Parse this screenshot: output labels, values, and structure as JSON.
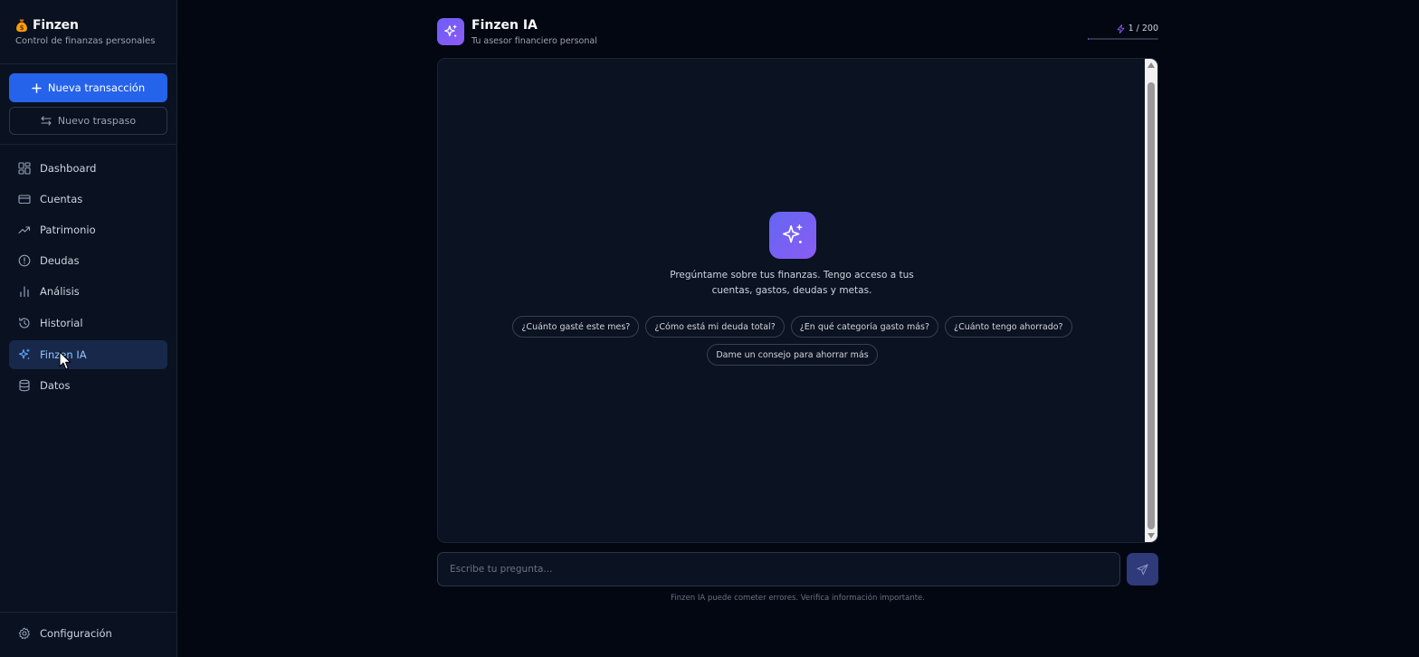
{
  "brand": {
    "title": "Finzen",
    "subtitle": "Control de finanzas personales",
    "icon": "money-bag-icon"
  },
  "actions": {
    "new_transaction": "Nueva transacción",
    "new_transfer": "Nuevo traspaso"
  },
  "nav": {
    "items": [
      {
        "label": "Dashboard",
        "icon": "grid-icon"
      },
      {
        "label": "Cuentas",
        "icon": "credit-card-icon"
      },
      {
        "label": "Patrimonio",
        "icon": "trending-up-icon"
      },
      {
        "label": "Deudas",
        "icon": "alert-circle-icon"
      },
      {
        "label": "Análisis",
        "icon": "bar-chart-icon"
      },
      {
        "label": "Historial",
        "icon": "history-icon"
      },
      {
        "label": "Finzen IA",
        "icon": "sparkles-icon",
        "active": true
      },
      {
        "label": "Datos",
        "icon": "database-icon"
      }
    ],
    "settings": "Configuración"
  },
  "chat": {
    "title": "Finzen IA",
    "subtitle": "Tu asesor financiero personal",
    "usage_label": "1 / 200",
    "usage_used": 1,
    "usage_limit": 200,
    "intro": "Pregúntame sobre tus finanzas. Tengo acceso a tus cuentas, gastos, deudas y metas.",
    "suggestions": [
      "¿Cuánto gasté este mes?",
      "¿Cómo está mi deuda total?",
      "¿En qué categoría gasto más?",
      "¿Cuánto tengo ahorrado?",
      "Dame un consejo para ahorrar más"
    ],
    "input_placeholder": "Escribe tu pregunta...",
    "disclaimer": "Finzen IA puede cometer errores. Verifica información importante."
  },
  "colors": {
    "background": "#030712",
    "sidebar": "#0a1120",
    "primary": "#2563eb",
    "accent": "#8b5cf6",
    "active_nav": "#17284a"
  }
}
